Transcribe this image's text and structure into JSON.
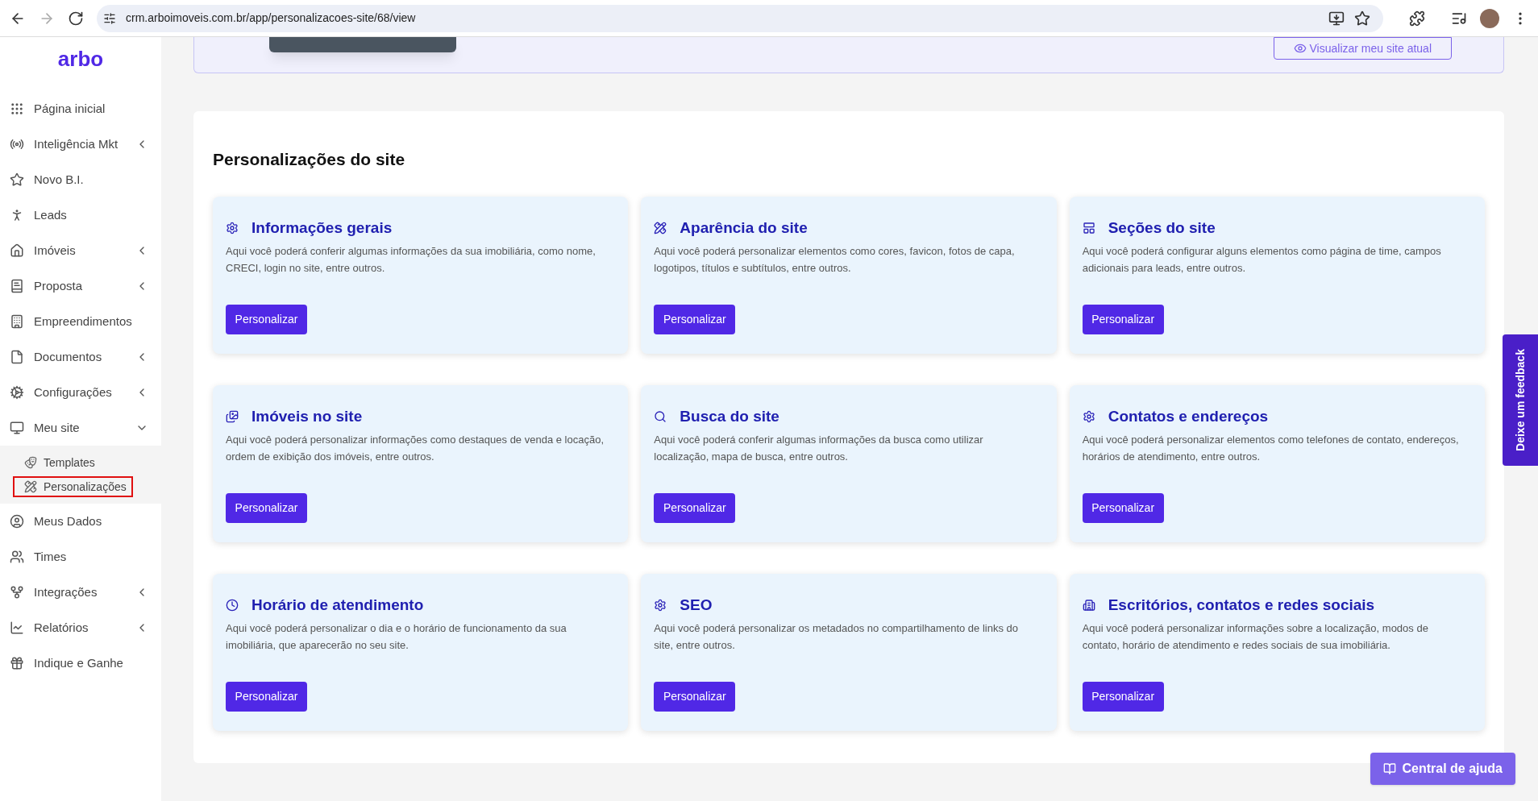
{
  "browser": {
    "url": "crm.arboimoveis.com.br/app/personalizacoes-site/68/view"
  },
  "sidebar": {
    "logo": "arbo",
    "items": [
      {
        "label": "Página inicial",
        "kind": "link"
      },
      {
        "label": "Inteligência Mkt",
        "kind": "group",
        "expanded": false
      },
      {
        "label": "Novo B.I.",
        "kind": "link"
      },
      {
        "label": "Leads",
        "kind": "link"
      },
      {
        "label": "Imóveis",
        "kind": "group",
        "expanded": false
      },
      {
        "label": "Proposta",
        "kind": "group",
        "expanded": false
      },
      {
        "label": "Empreendimentos",
        "kind": "link"
      },
      {
        "label": "Documentos",
        "kind": "group",
        "expanded": false
      },
      {
        "label": "Configurações",
        "kind": "group",
        "expanded": false
      },
      {
        "label": "Meu site",
        "kind": "group",
        "expanded": true,
        "children": [
          {
            "label": "Templates",
            "selected": false
          },
          {
            "label": "Personalizações",
            "selected": true
          }
        ]
      },
      {
        "label": "Meus Dados",
        "kind": "link"
      },
      {
        "label": "Times",
        "kind": "link"
      },
      {
        "label": "Integrações",
        "kind": "group",
        "expanded": false
      },
      {
        "label": "Relatórios",
        "kind": "group",
        "expanded": false
      },
      {
        "label": "Indique e Ganhe",
        "kind": "link"
      }
    ]
  },
  "banner": {
    "button": "Visualizar meu site atual"
  },
  "section": {
    "title": "Personalizações do site",
    "cards": [
      {
        "title": "Informações gerais",
        "description": "Aqui você poderá conferir algumas informações da sua imobiliária, como nome, CRECI, login no site, entre outros.",
        "button": "Personalizar"
      },
      {
        "title": "Aparência do site",
        "description": "Aqui você poderá personalizar elementos como cores, favicon, fotos de capa, logotipos, títulos e subtítulos, entre outros.",
        "button": "Personalizar"
      },
      {
        "title": "Seções do site",
        "description": "Aqui você poderá configurar alguns elementos como página de time, campos adicionais para leads, entre outros.",
        "button": "Personalizar"
      },
      {
        "title": "Imóveis no site",
        "description": "Aqui você poderá personalizar informações como destaques de venda e locação, ordem de exibição dos imóveis, entre outros.",
        "button": "Personalizar"
      },
      {
        "title": "Busca do site",
        "description": "Aqui você poderá conferir algumas informações da busca como utilizar localização, mapa de busca, entre outros.",
        "button": "Personalizar"
      },
      {
        "title": "Contatos e endereços",
        "description": "Aqui você poderá personalizar elementos como telefones de contato, endereços, horários de atendimento, entre outros.",
        "button": "Personalizar"
      },
      {
        "title": "Horário de atendimento",
        "description": "Aqui você poderá personalizar o dia e o horário de funcionamento da sua imobiliária, que aparecerão no seu site.",
        "button": "Personalizar"
      },
      {
        "title": "SEO",
        "description": "Aqui você poderá personalizar os metadados no compartilhamento de links do site, entre outros.",
        "button": "Personalizar"
      },
      {
        "title": "Escritórios, contatos e redes sociais",
        "description": "Aqui você poderá personalizar informações sobre a localização, modos de contato, horário de atendimento e redes sociais de sua imobiliária.",
        "button": "Personalizar"
      }
    ]
  },
  "feedback_tab": "Deixe um feedback",
  "help_button": "Central de ajuda"
}
